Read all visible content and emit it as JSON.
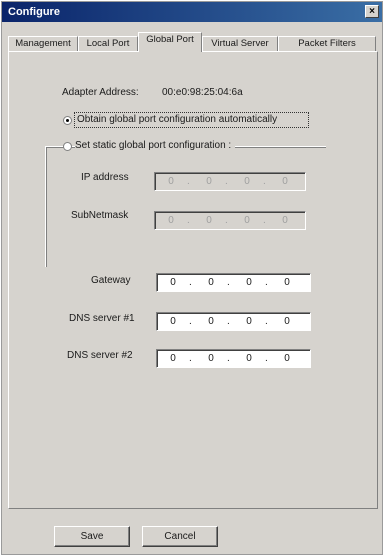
{
  "window": {
    "title": "Configure",
    "close": "×"
  },
  "tabs": [
    {
      "label": "Management"
    },
    {
      "label": "Local Port"
    },
    {
      "label": "Global Port"
    },
    {
      "label": "Virtual Server"
    },
    {
      "label": "Packet Filters"
    }
  ],
  "adapter": {
    "label": "Adapter Address:",
    "value": "00:e0:98:25:04:6a"
  },
  "radio_auto": {
    "label": "Obtain global port configuration automatically"
  },
  "radio_static": {
    "label": "Set static global port configuration :"
  },
  "fields": {
    "ip": {
      "label": "IP address",
      "octets": [
        "0",
        "0",
        "0",
        "0"
      ]
    },
    "subnet": {
      "label": "SubNetmask",
      "octets": [
        "0",
        "0",
        "0",
        "0"
      ]
    },
    "gateway": {
      "label": "Gateway",
      "octets": [
        "0",
        "0",
        "0",
        "0"
      ]
    },
    "dns1": {
      "label": "DNS server #1",
      "octets": [
        "0",
        "0",
        "0",
        "0"
      ]
    },
    "dns2": {
      "label": "DNS server #2",
      "octets": [
        "0",
        "0",
        "0",
        "0"
      ]
    },
    "separator": "."
  },
  "buttons": {
    "save": "Save",
    "cancel": "Cancel"
  }
}
